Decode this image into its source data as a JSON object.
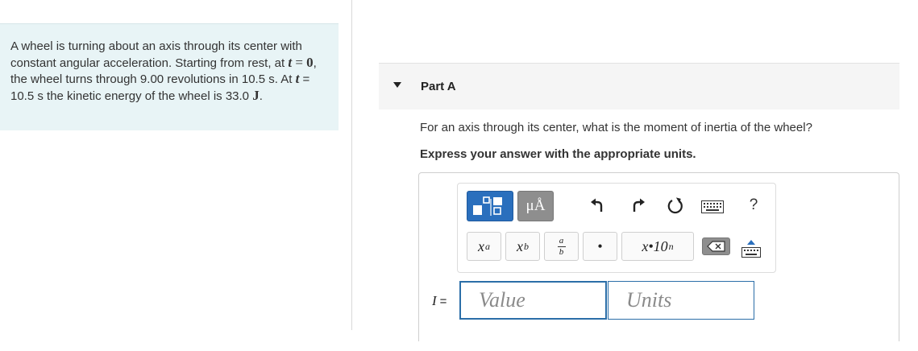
{
  "problem": {
    "parts": [
      {
        "t": "A wheel is turning about an axis through its center with constant angular acceleration. Starting from rest, at ",
        "s": ""
      },
      {
        "t": "t",
        "s": "math"
      },
      {
        "t": " = ",
        "s": "math-upright"
      },
      {
        "t": "0",
        "s": "math-bold"
      },
      {
        "t": ", the wheel turns through 9.00 revolutions in 10.5 s. At ",
        "s": ""
      },
      {
        "t": "t",
        "s": "math"
      },
      {
        "t": " = 10.5 s the kinetic energy of the wheel is 33.0 ",
        "s": ""
      },
      {
        "t": "J",
        "s": "math-bold"
      },
      {
        "t": ".",
        "s": ""
      }
    ]
  },
  "part": {
    "title": "Part A"
  },
  "question": "For an axis through its center, what is the moment of inertia of the wheel?",
  "instruction": "Express your answer with the appropriate units.",
  "toolbar": {
    "units_label": "μÅ",
    "help_label": "?",
    "sup_base": "x",
    "sup_exp": "a",
    "sub_base": "x",
    "sub_idx": "b",
    "frac_num": "a",
    "frac_den": "b",
    "dot_label": "•",
    "sci_label": "x•10",
    "sci_exp": "n"
  },
  "answer": {
    "variable": "I",
    "equals": "=",
    "value_placeholder": "Value",
    "units_placeholder": "Units"
  },
  "colors": {
    "problem_bg": "#e8f4f6",
    "template_button": "#2a6fbd",
    "units_button": "#8e8e8e",
    "input_border": "#2b6ea8"
  }
}
